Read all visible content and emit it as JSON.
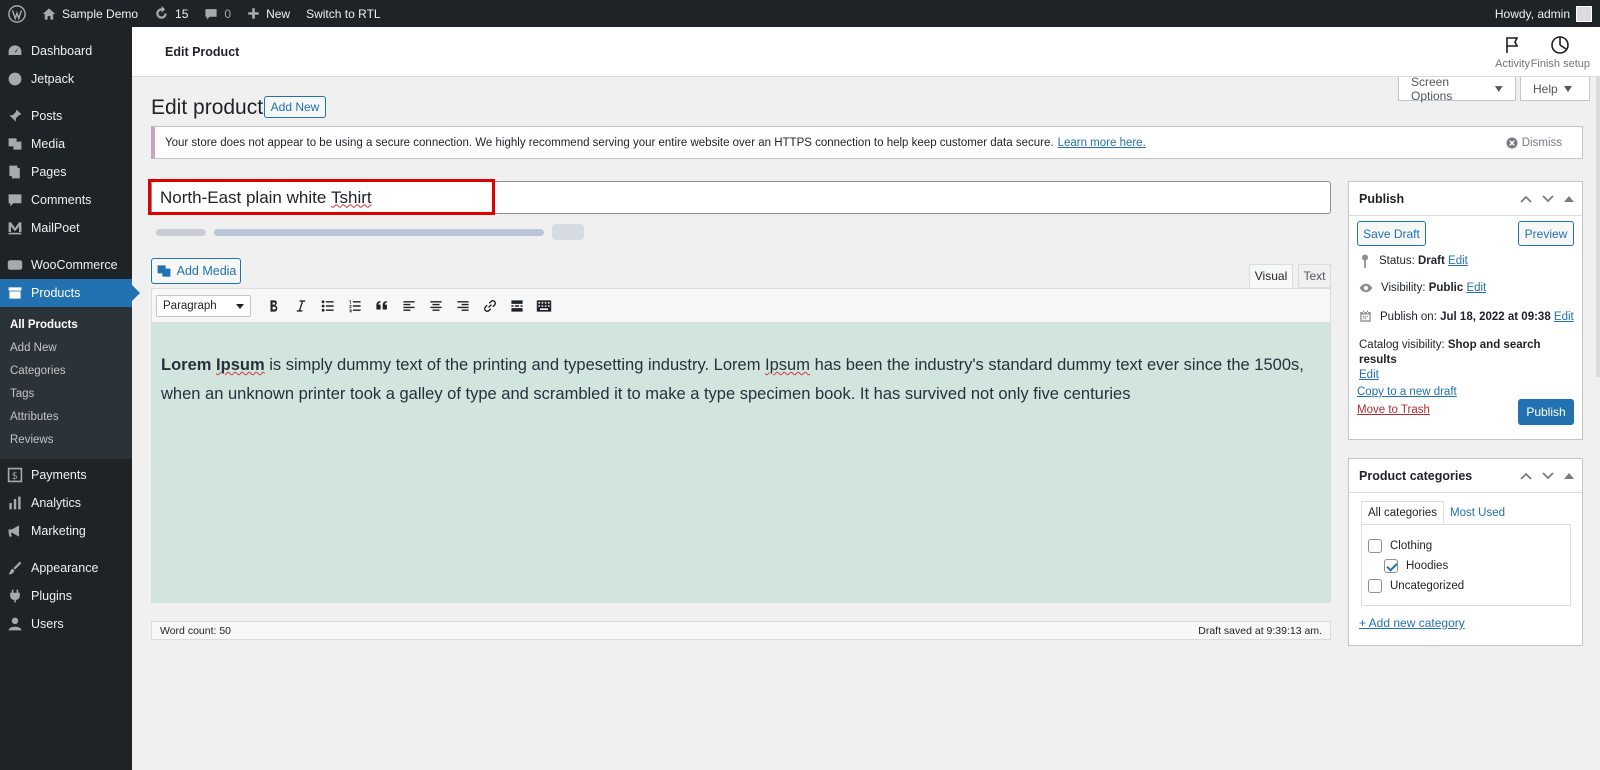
{
  "adminbar": {
    "site_name": "Sample Demo",
    "updates_count": "15",
    "comments_count": "0",
    "new_label": "New",
    "rtl_label": "Switch to RTL",
    "greeting": "Howdy, admin"
  },
  "sidebar": {
    "dashboard": "Dashboard",
    "jetpack": "Jetpack",
    "posts": "Posts",
    "media": "Media",
    "pages": "Pages",
    "comments": "Comments",
    "mailpoet": "MailPoet",
    "woocommerce": "WooCommerce",
    "products": "Products",
    "submenu": [
      "All Products",
      "Add New",
      "Categories",
      "Tags",
      "Attributes",
      "Reviews"
    ],
    "payments": "Payments",
    "analytics": "Analytics",
    "marketing": "Marketing",
    "appearance": "Appearance",
    "plugins": "Plugins",
    "users": "Users"
  },
  "header": {
    "title": "Edit Product",
    "activity": "Activity",
    "finish_setup": "Finish setup",
    "screen_options": "Screen Options",
    "help": "Help"
  },
  "page": {
    "heading": "Edit product",
    "add_new": "Add New"
  },
  "notice": {
    "text": "Your store does not appear to be using a secure connection. We highly recommend serving your entire website over an HTTPS connection to help keep customer data secure.",
    "link": "Learn more here.",
    "dismiss": "Dismiss"
  },
  "post": {
    "title_start": "North-East plain white ",
    "title_misspelled": "Tshirt"
  },
  "editor": {
    "add_media": "Add Media",
    "tab_visual": "Visual",
    "tab_text": "Text",
    "format": "Paragraph",
    "content_bold": "Lorem",
    "content_bold_misspelled": "Ipsum",
    "content_1": " is simply dummy text of the printing and typesetting industry. Lorem ",
    "content_misspelled": "Ipsum",
    "content_2": " has been the industry's standard dummy text ever since the 1500s, when an unknown printer took a galley of type and scrambled it to make a type specimen book. It has survived not only five centuries",
    "word_count": "Word count: 50",
    "draft_saved": "Draft saved at 9:39:13 am."
  },
  "publish": {
    "title": "Publish",
    "save_draft": "Save Draft",
    "preview": "Preview",
    "status_label": "Status: ",
    "status_value": "Draft",
    "visibility_label": "Visibility: ",
    "visibility_value": "Public",
    "publish_on_label": "Publish on: ",
    "publish_on_value": "Jul 18, 2022 at 09:38",
    "catalog_label": "Catalog visibility: ",
    "catalog_value": "Shop and search results",
    "edit": "Edit",
    "copy_draft": "Copy to a new draft",
    "trash": "Move to Trash",
    "publish_btn": "Publish"
  },
  "categories": {
    "title": "Product categories",
    "tab_all": "All categories",
    "tab_most_used": "Most Used",
    "items": [
      {
        "label": "Clothing",
        "checked": false
      },
      {
        "label": "Hoodies",
        "checked": true
      },
      {
        "label": "Uncategorized",
        "checked": false
      }
    ],
    "add_new": "+ Add new category"
  },
  "colors": {
    "accent": "#2271b1",
    "editor_bg": "#d1e4dd",
    "highlight": "#e00000"
  }
}
